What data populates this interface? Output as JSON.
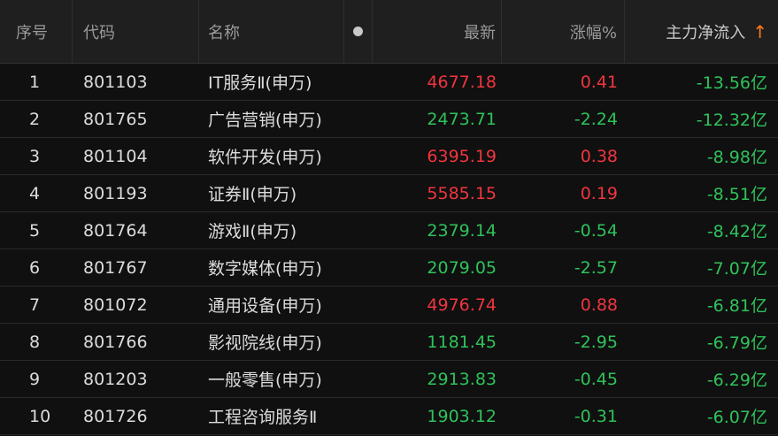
{
  "header": {
    "idx": "序号",
    "code": "代码",
    "name": "名称",
    "last": "最新",
    "chg": "涨幅%",
    "flow": "主力净流入",
    "sort_arrow": "↑"
  },
  "colors": {
    "up": "#f0353f",
    "down": "#2fc25b",
    "sort_accent": "#ff7a1a"
  },
  "rows": [
    {
      "idx": "1",
      "code": "801103",
      "name": "IT服务Ⅱ(申万)",
      "last": "4677.18",
      "chg": "0.41",
      "flow": "-13.56亿",
      "dir": "up"
    },
    {
      "idx": "2",
      "code": "801765",
      "name": "广告营销(申万)",
      "last": "2473.71",
      "chg": "-2.24",
      "flow": "-12.32亿",
      "dir": "down"
    },
    {
      "idx": "3",
      "code": "801104",
      "name": "软件开发(申万)",
      "last": "6395.19",
      "chg": "0.38",
      "flow": "-8.98亿",
      "dir": "up"
    },
    {
      "idx": "4",
      "code": "801193",
      "name": "证券Ⅱ(申万)",
      "last": "5585.15",
      "chg": "0.19",
      "flow": "-8.51亿",
      "dir": "up"
    },
    {
      "idx": "5",
      "code": "801764",
      "name": "游戏Ⅱ(申万)",
      "last": "2379.14",
      "chg": "-0.54",
      "flow": "-8.42亿",
      "dir": "down"
    },
    {
      "idx": "6",
      "code": "801767",
      "name": "数字媒体(申万)",
      "last": "2079.05",
      "chg": "-2.57",
      "flow": "-7.07亿",
      "dir": "down"
    },
    {
      "idx": "7",
      "code": "801072",
      "name": "通用设备(申万)",
      "last": "4976.74",
      "chg": "0.88",
      "flow": "-6.81亿",
      "dir": "up"
    },
    {
      "idx": "8",
      "code": "801766",
      "name": "影视院线(申万)",
      "last": "1181.45",
      "chg": "-2.95",
      "flow": "-6.79亿",
      "dir": "down"
    },
    {
      "idx": "9",
      "code": "801203",
      "name": "一般零售(申万)",
      "last": "2913.83",
      "chg": "-0.45",
      "flow": "-6.29亿",
      "dir": "down"
    },
    {
      "idx": "10",
      "code": "801726",
      "name": "工程咨询服务Ⅱ",
      "last": "1903.12",
      "chg": "-0.31",
      "flow": "-6.07亿",
      "dir": "down"
    }
  ]
}
